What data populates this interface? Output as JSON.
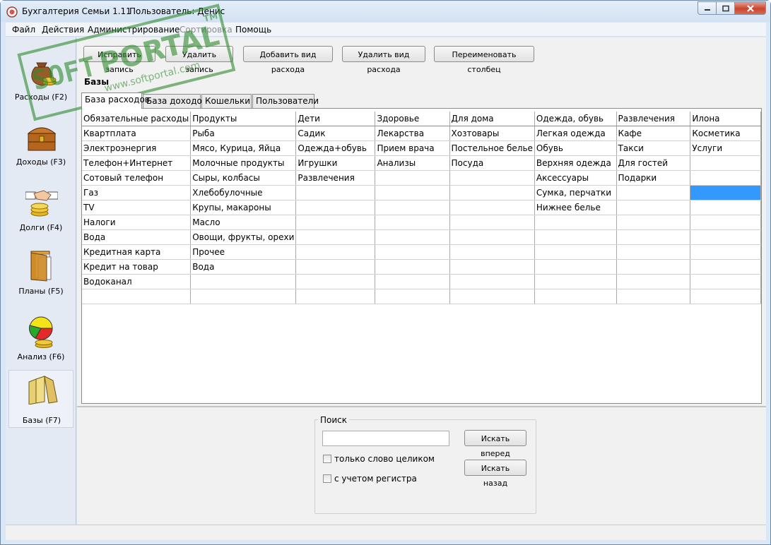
{
  "window": {
    "title": "Бухгалтерия Семьи 1.11",
    "user": "Пользователь: Денис"
  },
  "menu": [
    "Файл",
    "Действия",
    "Администрирование",
    "Сортировка",
    "Помощь"
  ],
  "sidebar": {
    "items": [
      {
        "label": "Расходы (F2)",
        "icon": "coin-bag-icon"
      },
      {
        "label": "Доходы (F3)",
        "icon": "treasure-chest-icon"
      },
      {
        "label": "Долги (F4)",
        "icon": "handshake-coins-icon"
      },
      {
        "label": "Планы (F5)",
        "icon": "folder-documents-icon"
      },
      {
        "label": "Анализ (F6)",
        "icon": "pie-chart-coins-icon"
      },
      {
        "label": "Базы (F7)",
        "icon": "books-icon"
      }
    ],
    "active_index": 5
  },
  "toolbar": {
    "edit": "Исправить запись",
    "delete": "Удалить запись",
    "add_type": "Добавить вид расхода",
    "delete_type": "Удалить вид расхода",
    "rename_column": "Переименовать столбец"
  },
  "section_title": "Базы",
  "tabs": [
    "База расходов",
    "База доходов",
    "Кошельки",
    "Пользователи"
  ],
  "grid": {
    "columns": [
      "Обязательные расходы",
      "Продукты",
      "Дети",
      "Здоровье",
      "Для дома",
      "Одежда, обувь",
      "Развлечения",
      "Илона"
    ],
    "rows": [
      [
        "Квартплата",
        "Рыба",
        "Садик",
        "Лекарства",
        "Хозтовары",
        "Легкая одежда",
        "Кафе",
        "Косметика"
      ],
      [
        "Электроэнергия",
        "Мясо, Курица, Яйца",
        "Одежда+обувь",
        "Прием врача",
        "Постельное белье",
        "Обувь",
        "Такси",
        "Услуги"
      ],
      [
        "Телефон+Интернет",
        "Молочные продукты",
        "Игрушки",
        "Анализы",
        "Посуда",
        "Верхняя одежда",
        "Для гостей",
        ""
      ],
      [
        "Сотовый телефон",
        "Сыры, колбасы",
        "Развлечения",
        "",
        "",
        "Аксессуары",
        "Подарки",
        ""
      ],
      [
        "Газ",
        "Хлебобулочные",
        "",
        "",
        "",
        "Сумка, перчатки",
        "",
        ""
      ],
      [
        "TV",
        "Крупы, макароны",
        "",
        "",
        "",
        "Нижнее белье",
        "",
        ""
      ],
      [
        "Налоги",
        "Масло",
        "",
        "",
        "",
        "",
        "",
        ""
      ],
      [
        "Вода",
        "Овощи, фрукты, орехи",
        "",
        "",
        "",
        "",
        "",
        ""
      ],
      [
        "Кредитная карта",
        "Прочее",
        "",
        "",
        "",
        "",
        "",
        ""
      ],
      [
        "Кредит на товар",
        "Вода",
        "",
        "",
        "",
        "",
        "",
        ""
      ],
      [
        "Водоканал",
        "",
        "",
        "",
        "",
        "",
        "",
        ""
      ],
      [
        "",
        "",
        "",
        "",
        "",
        "",
        "",
        ""
      ]
    ],
    "selected_cell": [
      4,
      7
    ],
    "selected_color": "#3399ff"
  },
  "search": {
    "legend": "Поиск",
    "value": "",
    "forward": "Искать вперед",
    "back": "Искать назад",
    "whole_word": "только слово целиком",
    "match_case": "с учетом регистра",
    "whole_word_checked": false,
    "match_case_checked": false
  },
  "watermark": {
    "brand": "PORTAL",
    "prefix": "SOFT",
    "url": "www.softportal.com",
    "tm": "TM",
    "color": "#2e8b2e"
  }
}
